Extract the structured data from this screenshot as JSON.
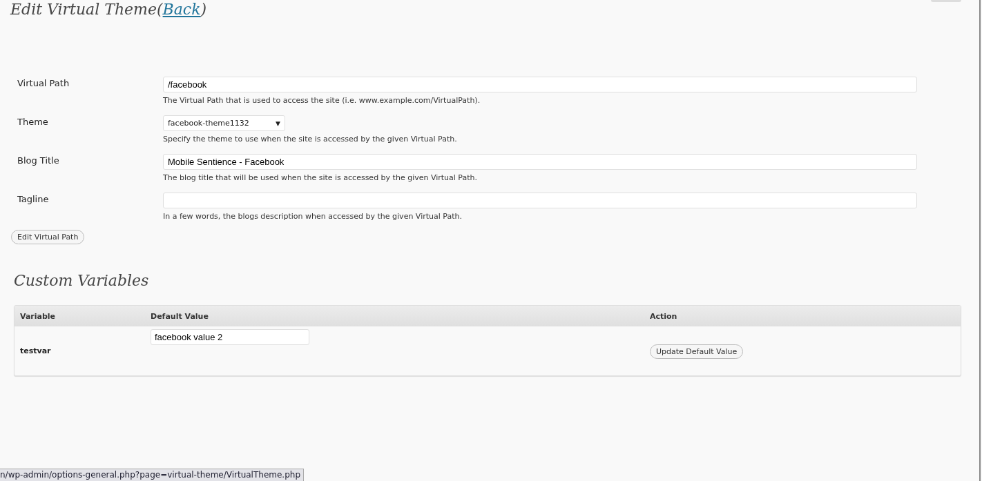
{
  "heading": {
    "title": "Edit Virtual Theme(",
    "link": "Back",
    "close": ")"
  },
  "fields": [
    {
      "kind": "text",
      "label": "Virtual Path",
      "value": "/facebook",
      "description": "The Virtual Path that is used to access the site (i.e. www.example.com/VirtualPath)."
    },
    {
      "kind": "select",
      "label": "Theme",
      "value": "facebook-theme1132",
      "arrow": "▼",
      "description": "Specify the theme to use when the site is accessed by the given Virtual Path."
    },
    {
      "kind": "text",
      "label": "Blog Title",
      "value": "Mobile Sentience - Facebook",
      "description": "The blog title that will be used when the site is accessed by the given Virtual Path."
    },
    {
      "kind": "text",
      "label": "Tagline",
      "description": "In a few words, the blogs description when accessed by the given Virtual Path."
    }
  ],
  "submit_button": "Edit Virtual Path",
  "custom_variables": {
    "title": "Custom Variables",
    "columns": [
      "Variable",
      "Default Value",
      "Action"
    ],
    "rows": [
      {
        "variable": "testvar",
        "default_value": "facebook value 2",
        "action": "Update Default Value"
      }
    ]
  },
  "status_bar": "n/wp-admin/options-general.php?page=virtual-theme/VirtualTheme.php"
}
